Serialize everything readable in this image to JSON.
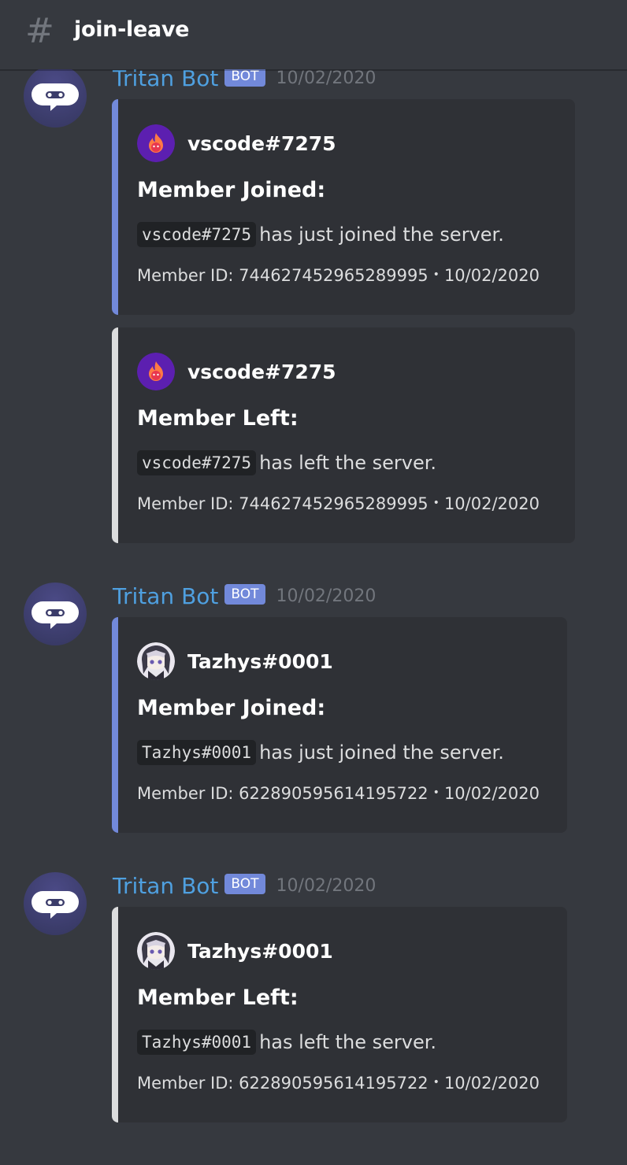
{
  "channel": {
    "hash_icon": "hash-icon",
    "name": "join-leave"
  },
  "colors": {
    "join_bar": "#7289da",
    "leave_bar": "#dcddde",
    "username": "#4fa0e0",
    "bot_tag": "#7289da"
  },
  "messages": [
    {
      "username": "Tritan Bot",
      "bot_tag": "BOT",
      "timestamp": "10/02/2020",
      "embeds": [
        {
          "author": "vscode#7275",
          "author_avatar": "fire-avatar",
          "title": "Member Joined:",
          "code": "vscode#7275",
          "text": "has just joined the server.",
          "footer_id": "Member ID: 744627452965289995",
          "footer_sep": "•",
          "footer_date": "10/02/2020"
        },
        {
          "author": "vscode#7275",
          "author_avatar": "fire-avatar",
          "title": "Member Left:",
          "code": "vscode#7275",
          "text": "has left the server.",
          "footer_id": "Member ID: 744627452965289995",
          "footer_sep": "•",
          "footer_date": "10/02/2020"
        }
      ]
    },
    {
      "username": "Tritan Bot",
      "bot_tag": "BOT",
      "timestamp": "10/02/2020",
      "embeds": [
        {
          "author": "Tazhys#0001",
          "author_avatar": "anime-avatar",
          "title": "Member Joined:",
          "code": "Tazhys#0001",
          "text": "has just joined the server.",
          "footer_id": "Member ID: 622890595614195722",
          "footer_sep": "•",
          "footer_date": "10/02/2020"
        }
      ]
    },
    {
      "username": "Tritan Bot",
      "bot_tag": "BOT",
      "timestamp": "10/02/2020",
      "embeds": [
        {
          "author": "Tazhys#0001",
          "author_avatar": "anime-avatar",
          "title": "Member Left:",
          "code": "Tazhys#0001",
          "text": "has left the server.",
          "footer_id": "Member ID: 622890595614195722",
          "footer_sep": "•",
          "footer_date": "10/02/2020"
        }
      ]
    }
  ]
}
